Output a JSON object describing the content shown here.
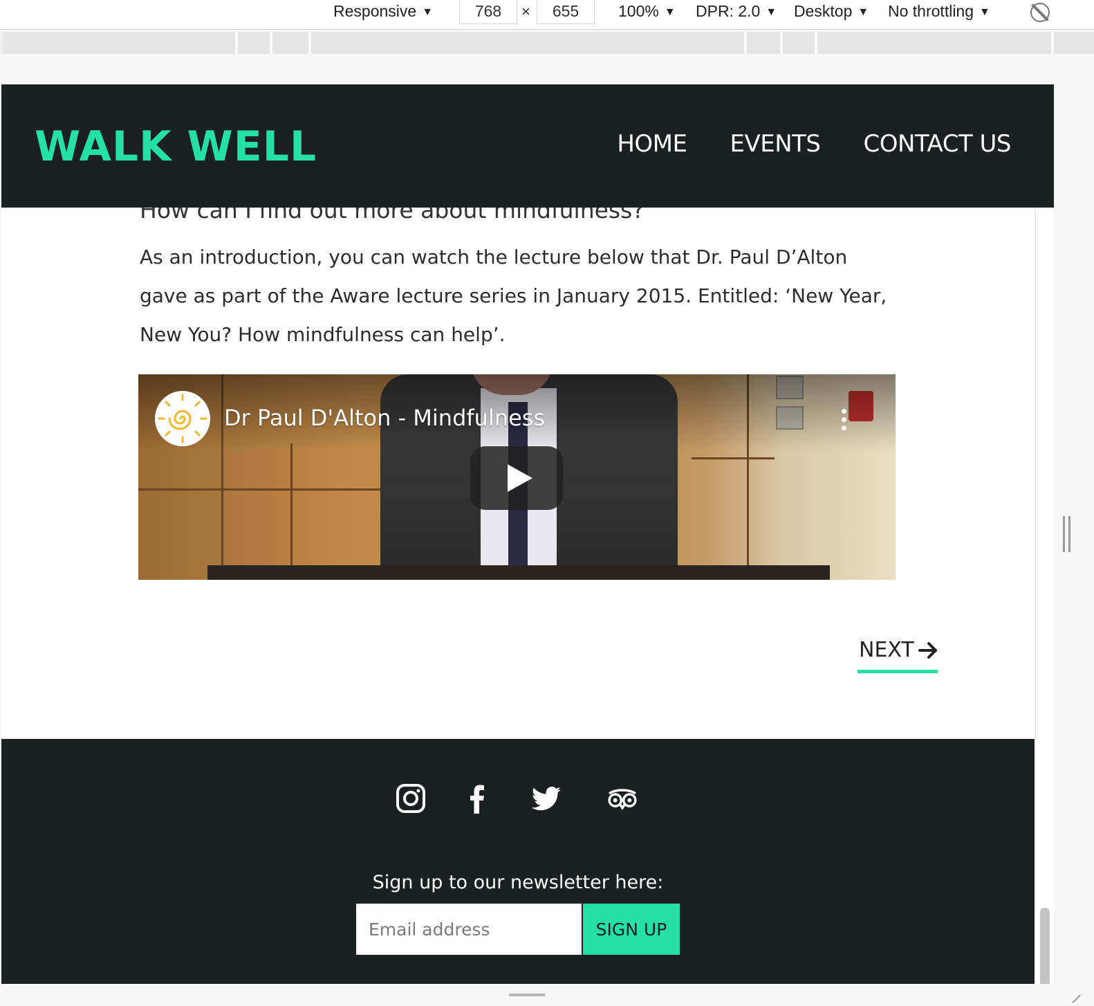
{
  "devtools": {
    "device": "Responsive",
    "width": "768",
    "times": "×",
    "height": "655",
    "zoom": "100%",
    "dpr": "DPR: 2.0",
    "mode": "Desktop",
    "throttling": "No throttling"
  },
  "site": {
    "logo": "WALK WELL",
    "nav": [
      "HOME",
      "EVENTS",
      "CONTACT US"
    ],
    "accent_color": "#25e0a4",
    "header_color": "#1a2120"
  },
  "content": {
    "question": "How can I find out more about mindfulness?",
    "intro": "As an introduction, you can watch the lecture below that Dr. Paul D’Alton gave as part of the Aware lecture series in January 2015. Entitled: ‘New Year, New You? How mindfulness can help’.",
    "video": {
      "title": "Dr Paul D'Alton - Mindfulness"
    },
    "next_label": "NEXT"
  },
  "footer": {
    "socials": [
      "instagram-icon",
      "facebook-icon",
      "twitter-icon",
      "tripadvisor-icon"
    ],
    "newsletter_label": "Sign up to our newsletter here:",
    "email_placeholder": "Email address",
    "signup_label": "SIGN UP"
  }
}
